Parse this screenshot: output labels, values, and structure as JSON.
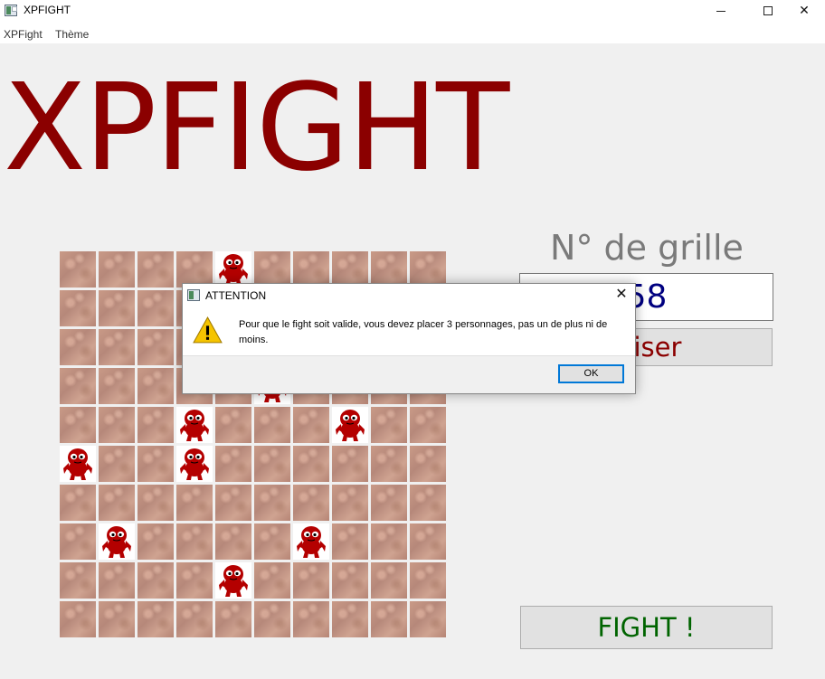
{
  "window": {
    "title": "XPFIGHT",
    "min_symbol": "",
    "max_symbol": "",
    "close_symbol": "✕"
  },
  "menu": {
    "items": [
      "XPFight",
      "Thème"
    ]
  },
  "header": {
    "title": "XPFIGHT",
    "title_color": "#8b0000"
  },
  "grid": {
    "rows": 10,
    "cols": 10,
    "occupied": [
      [
        0,
        4
      ],
      [
        3,
        5
      ],
      [
        4,
        3
      ],
      [
        4,
        7
      ],
      [
        5,
        0
      ],
      [
        5,
        3
      ],
      [
        7,
        1
      ],
      [
        7,
        6
      ],
      [
        8,
        4
      ]
    ],
    "piece_icon": "red-monster-icon",
    "piece_color": "#b40000"
  },
  "panel": {
    "grille_label": "N° de grille",
    "grille_value": "58",
    "reset_label": "aliser",
    "fight_label": "FIGHT !"
  },
  "dialog": {
    "title": "ATTENTION",
    "close_symbol": "✕",
    "icon": "warning-icon",
    "message": "Pour que le fight soit valide, vous devez placer 3 personnages, pas un de plus ni de moins.",
    "ok_label": "OK"
  }
}
